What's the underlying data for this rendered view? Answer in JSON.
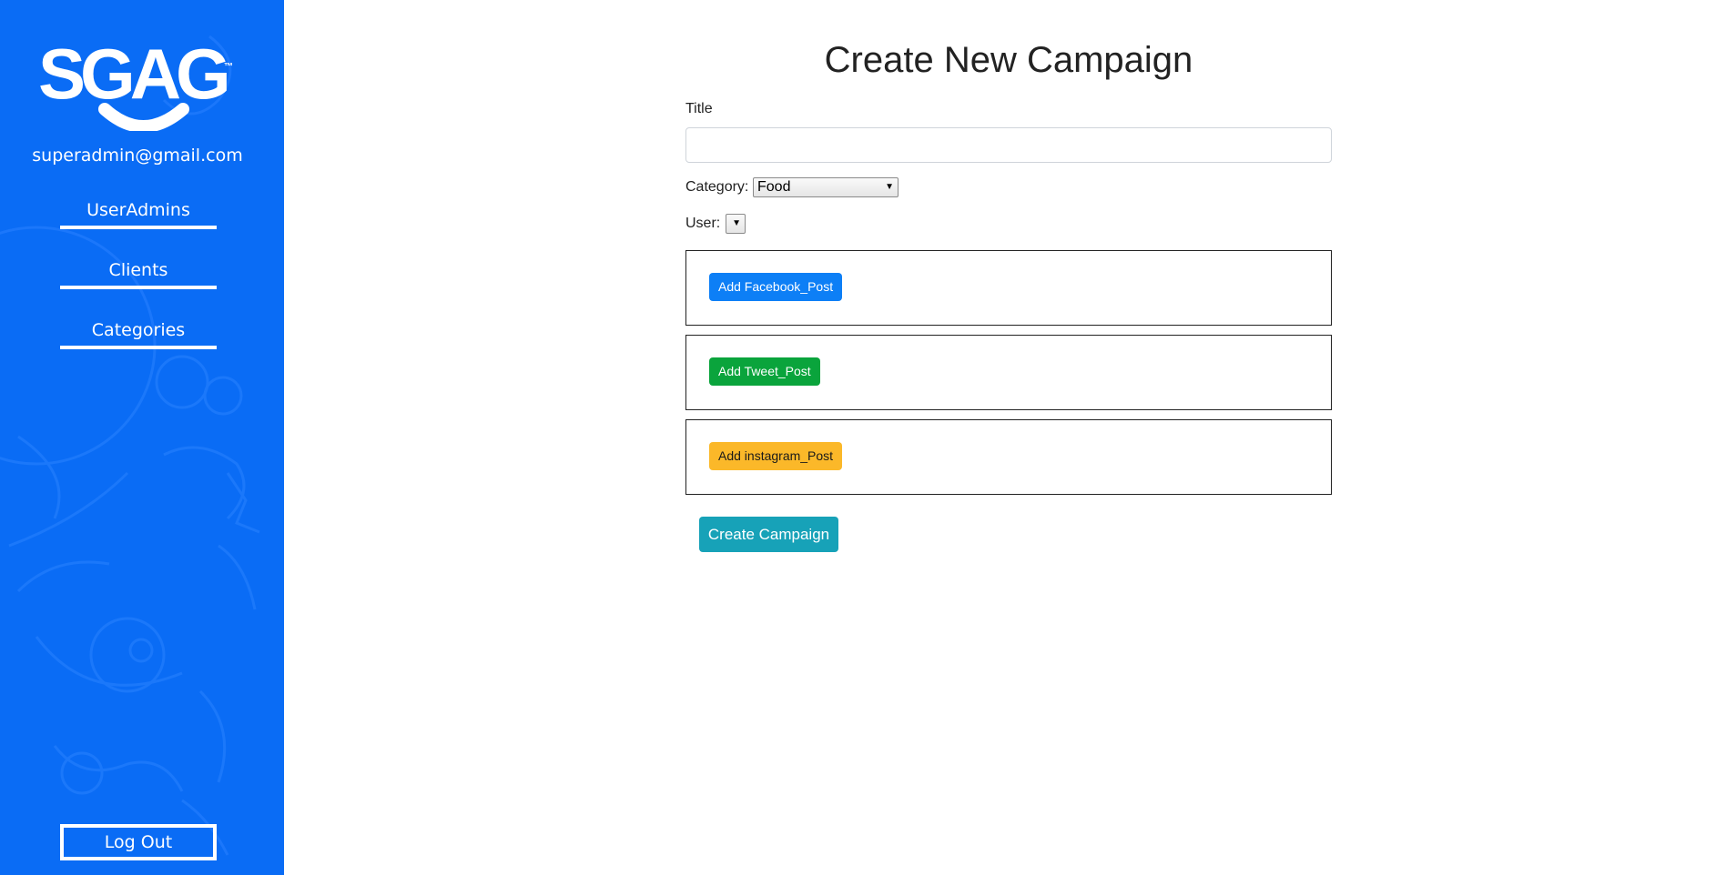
{
  "sidebar": {
    "logo_text": "SGAG",
    "email": "superadmin@gmail.com",
    "nav": [
      {
        "label": "UserAdmins"
      },
      {
        "label": "Clients"
      },
      {
        "label": "Categories"
      }
    ],
    "logout_label": "Log Out",
    "bg_color": "#0a6cf5"
  },
  "main": {
    "page_title": "Create New Campaign",
    "title_label": "Title",
    "title_value": "",
    "category_label": "Category:",
    "category_selected": "Food",
    "user_label": "User:",
    "user_selected": "",
    "posts": [
      {
        "label": "Add Facebook_Post",
        "color": "#0d7ff6",
        "text_color": "#ffffff"
      },
      {
        "label": "Add Tweet_Post",
        "color": "#0aa43c",
        "text_color": "#ffffff"
      },
      {
        "label": "Add instagram_Post",
        "color": "#fbb829",
        "text_color": "#1a1a1a"
      }
    ],
    "create_label": "Create Campaign"
  }
}
